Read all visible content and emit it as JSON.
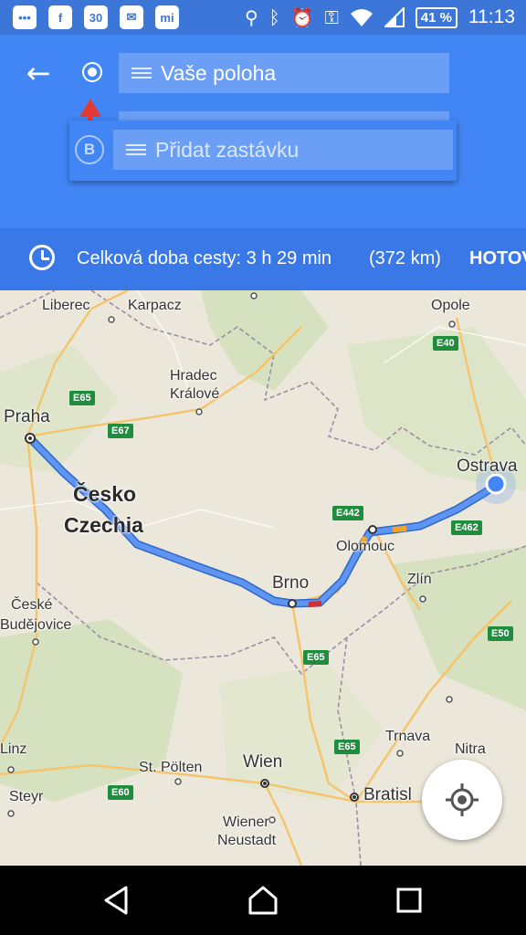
{
  "status_bar": {
    "left_icons": [
      {
        "name": "chat-icon",
        "glyph": "•••"
      },
      {
        "name": "facebook-icon",
        "glyph": "f"
      },
      {
        "name": "calendar-icon",
        "glyph": "30"
      },
      {
        "name": "messenger-icon",
        "glyph": "✉"
      },
      {
        "name": "mi-icon",
        "glyph": "mi"
      }
    ],
    "battery": "41 %",
    "time": "11:13"
  },
  "header": {
    "origin_value": "Vaše poloha",
    "stop_marker": "B",
    "stop_placeholder": "Přidat zastávku"
  },
  "summary": {
    "duration": "Celková doba cesty: 3 h 29 min",
    "distance": "(372 km)",
    "done": "HOTOVO"
  },
  "map": {
    "colors": {
      "route": "#4f86ec",
      "route_outline": "#2f67c9",
      "current_location": "#4285f4",
      "highway_shield": "#1e8e3e"
    },
    "cities": [
      {
        "id": "liberec",
        "name": "Liberec"
      },
      {
        "id": "karpacz",
        "name": "Karpacz"
      },
      {
        "id": "opole",
        "name": "Opole"
      },
      {
        "id": "hradec",
        "name": "Hradec\nKrálové"
      },
      {
        "id": "praha",
        "name": "Praha"
      },
      {
        "id": "ostrava",
        "name": "Ostrava"
      },
      {
        "id": "cesko",
        "name": "Česko"
      },
      {
        "id": "czechia",
        "name": "Czechia"
      },
      {
        "id": "olomouc",
        "name": "Olomouc"
      },
      {
        "id": "zlin",
        "name": "Zlín"
      },
      {
        "id": "brno",
        "name": "Brno"
      },
      {
        "id": "ceske",
        "name": "České"
      },
      {
        "id": "budejovice",
        "name": "Budějovice"
      },
      {
        "id": "linz",
        "name": "Linz"
      },
      {
        "id": "trnava",
        "name": "Trnava"
      },
      {
        "id": "nitra",
        "name": "Nitra"
      },
      {
        "id": "stpolten",
        "name": "St. Pölten"
      },
      {
        "id": "wien",
        "name": "Wien"
      },
      {
        "id": "steyr",
        "name": "Steyr"
      },
      {
        "id": "bratislava",
        "name": "Bratisl"
      },
      {
        "id": "wiener",
        "name": "Wiener"
      },
      {
        "id": "neustadt",
        "name": "Neustadt"
      }
    ],
    "shields": [
      "E65",
      "E67",
      "E40",
      "E442",
      "E462",
      "E50",
      "E65",
      "E65",
      "E60"
    ]
  },
  "nav_bar": {
    "icons": [
      "back-icon",
      "home-icon",
      "recents-icon"
    ]
  }
}
